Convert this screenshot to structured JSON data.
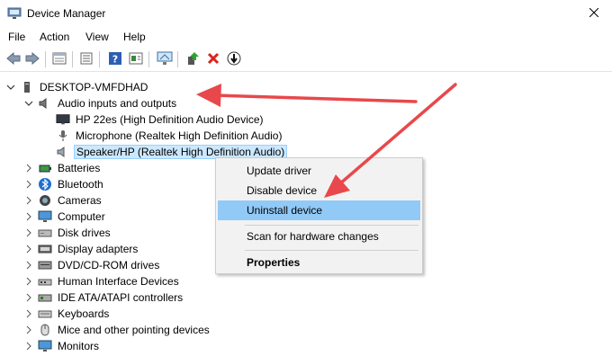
{
  "window": {
    "title": "Device Manager"
  },
  "menu": {
    "file": "File",
    "action": "Action",
    "view": "View",
    "help": "Help"
  },
  "toolbar": {
    "icons": [
      "back-icon",
      "forward-icon",
      "properties-view-icon",
      "list-icon",
      "help-icon",
      "show-hidden-icon",
      "monitor-scan-icon",
      "update-driver-icon",
      "uninstall-icon",
      "disable-icon"
    ]
  },
  "tree": {
    "root": "DESKTOP-VMFDHAD",
    "audio": {
      "label": "Audio inputs and outputs",
      "children": [
        "HP 22es (High Definition Audio Device)",
        "Microphone (Realtek High Definition Audio)",
        "Speaker/HP (Realtek High Definition Audio)"
      ]
    },
    "categories": [
      "Batteries",
      "Bluetooth",
      "Cameras",
      "Computer",
      "Disk drives",
      "Display adapters",
      "DVD/CD-ROM drives",
      "Human Interface Devices",
      "IDE ATA/ATAPI controllers",
      "Keyboards",
      "Mice and other pointing devices",
      "Monitors"
    ]
  },
  "context_menu": {
    "update": "Update driver",
    "disable": "Disable device",
    "uninstall": "Uninstall device",
    "scan": "Scan for hardware changes",
    "properties": "Properties"
  },
  "colors": {
    "annotation_arrow": "#e8484b",
    "selection_bg": "#cce8ff",
    "menu_highlight": "#91c9f7"
  }
}
